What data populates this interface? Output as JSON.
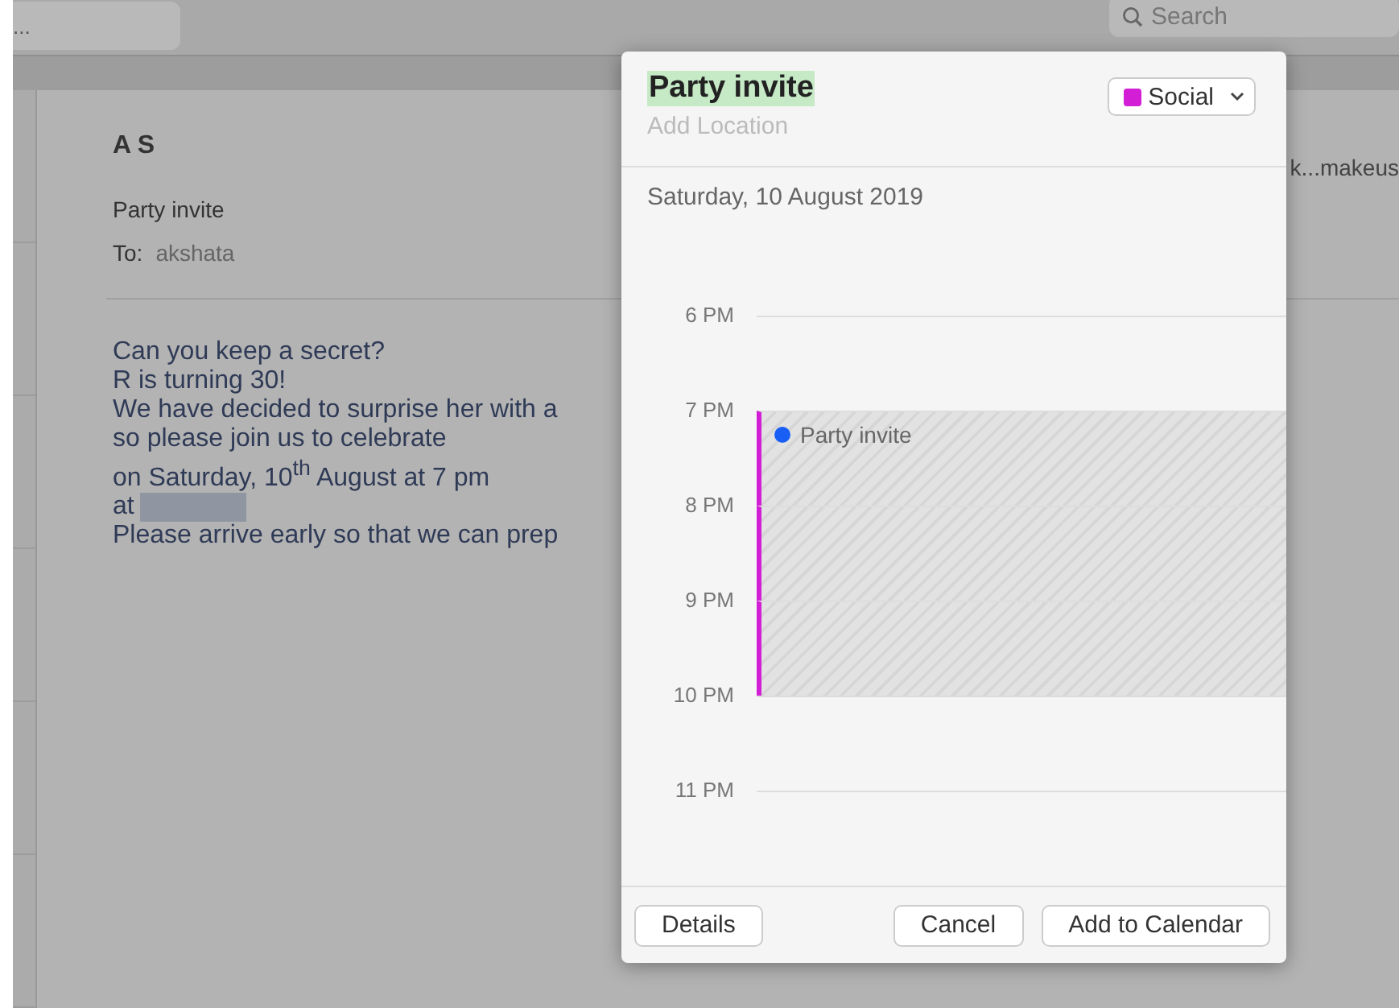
{
  "mail": {
    "toolbar_field": "...",
    "search": {
      "placeholder": "Search"
    },
    "sender": "A S",
    "subject": "Party invite",
    "to_label": "To:",
    "to": "akshata",
    "side_text": "k...makeus",
    "body": [
      {
        "kind": "text",
        "text": "Can you keep a secret?"
      },
      {
        "kind": "text",
        "text": "R is turning 30!"
      },
      {
        "kind": "text",
        "text": "We have decided to surprise her with a"
      },
      {
        "kind": "text",
        "text": "so please join us to celebrate"
      },
      {
        "kind": "text",
        "text": "on Saturday, 10$^{th}$ August at 7 pm"
      },
      {
        "kind": "redacted",
        "text": "at"
      },
      {
        "kind": "text",
        "text": "Please arrive early so that we can prep"
      }
    ]
  },
  "popover": {
    "title": {
      "text": "Party invite",
      "selected": true
    },
    "location": {
      "placeholder": "Add Location"
    },
    "calendar": {
      "label": "Social",
      "color": "#d21fd6"
    },
    "date": "Saturday, 10 August 2019",
    "hours": [
      {
        "label": "6 PM",
        "booked": false
      },
      {
        "label": "7 PM",
        "booked": true
      },
      {
        "label": "8 PM",
        "booked": true
      },
      {
        "label": "9 PM",
        "booked": true
      },
      {
        "label": "10 PM",
        "booked": false
      },
      {
        "label": "11 PM",
        "booked": false
      }
    ],
    "event": {
      "title": "Party invite"
    },
    "left_buttons": [
      "Details"
    ],
    "right_buttons": [
      "Cancel",
      "Add to Calendar"
    ]
  }
}
